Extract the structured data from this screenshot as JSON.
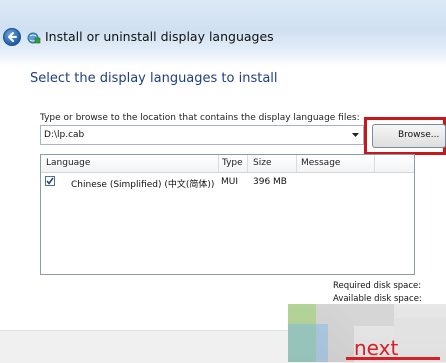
{
  "window": {
    "title": "Install or uninstall display languages"
  },
  "page": {
    "heading": "Select the display languages to install"
  },
  "location": {
    "label": "Type or browse to the location that contains the display language files:",
    "value": "D:\\lp.cab",
    "browse_label": "Browse..."
  },
  "table": {
    "columns": [
      "Language",
      "Type",
      "Size",
      "Message"
    ],
    "rows": [
      {
        "checked": true,
        "language": "Chinese (Simplified) (中文(简体))",
        "type": "MUI",
        "size": "396 MB",
        "message": ""
      }
    ]
  },
  "disk": {
    "required_label": "Required disk space:",
    "available_label": "Available disk space:"
  },
  "footer": {
    "next_label": "next"
  },
  "colors": {
    "heading": "#1e3d8a",
    "highlight": "#c8181e",
    "next": "#d81f26"
  }
}
